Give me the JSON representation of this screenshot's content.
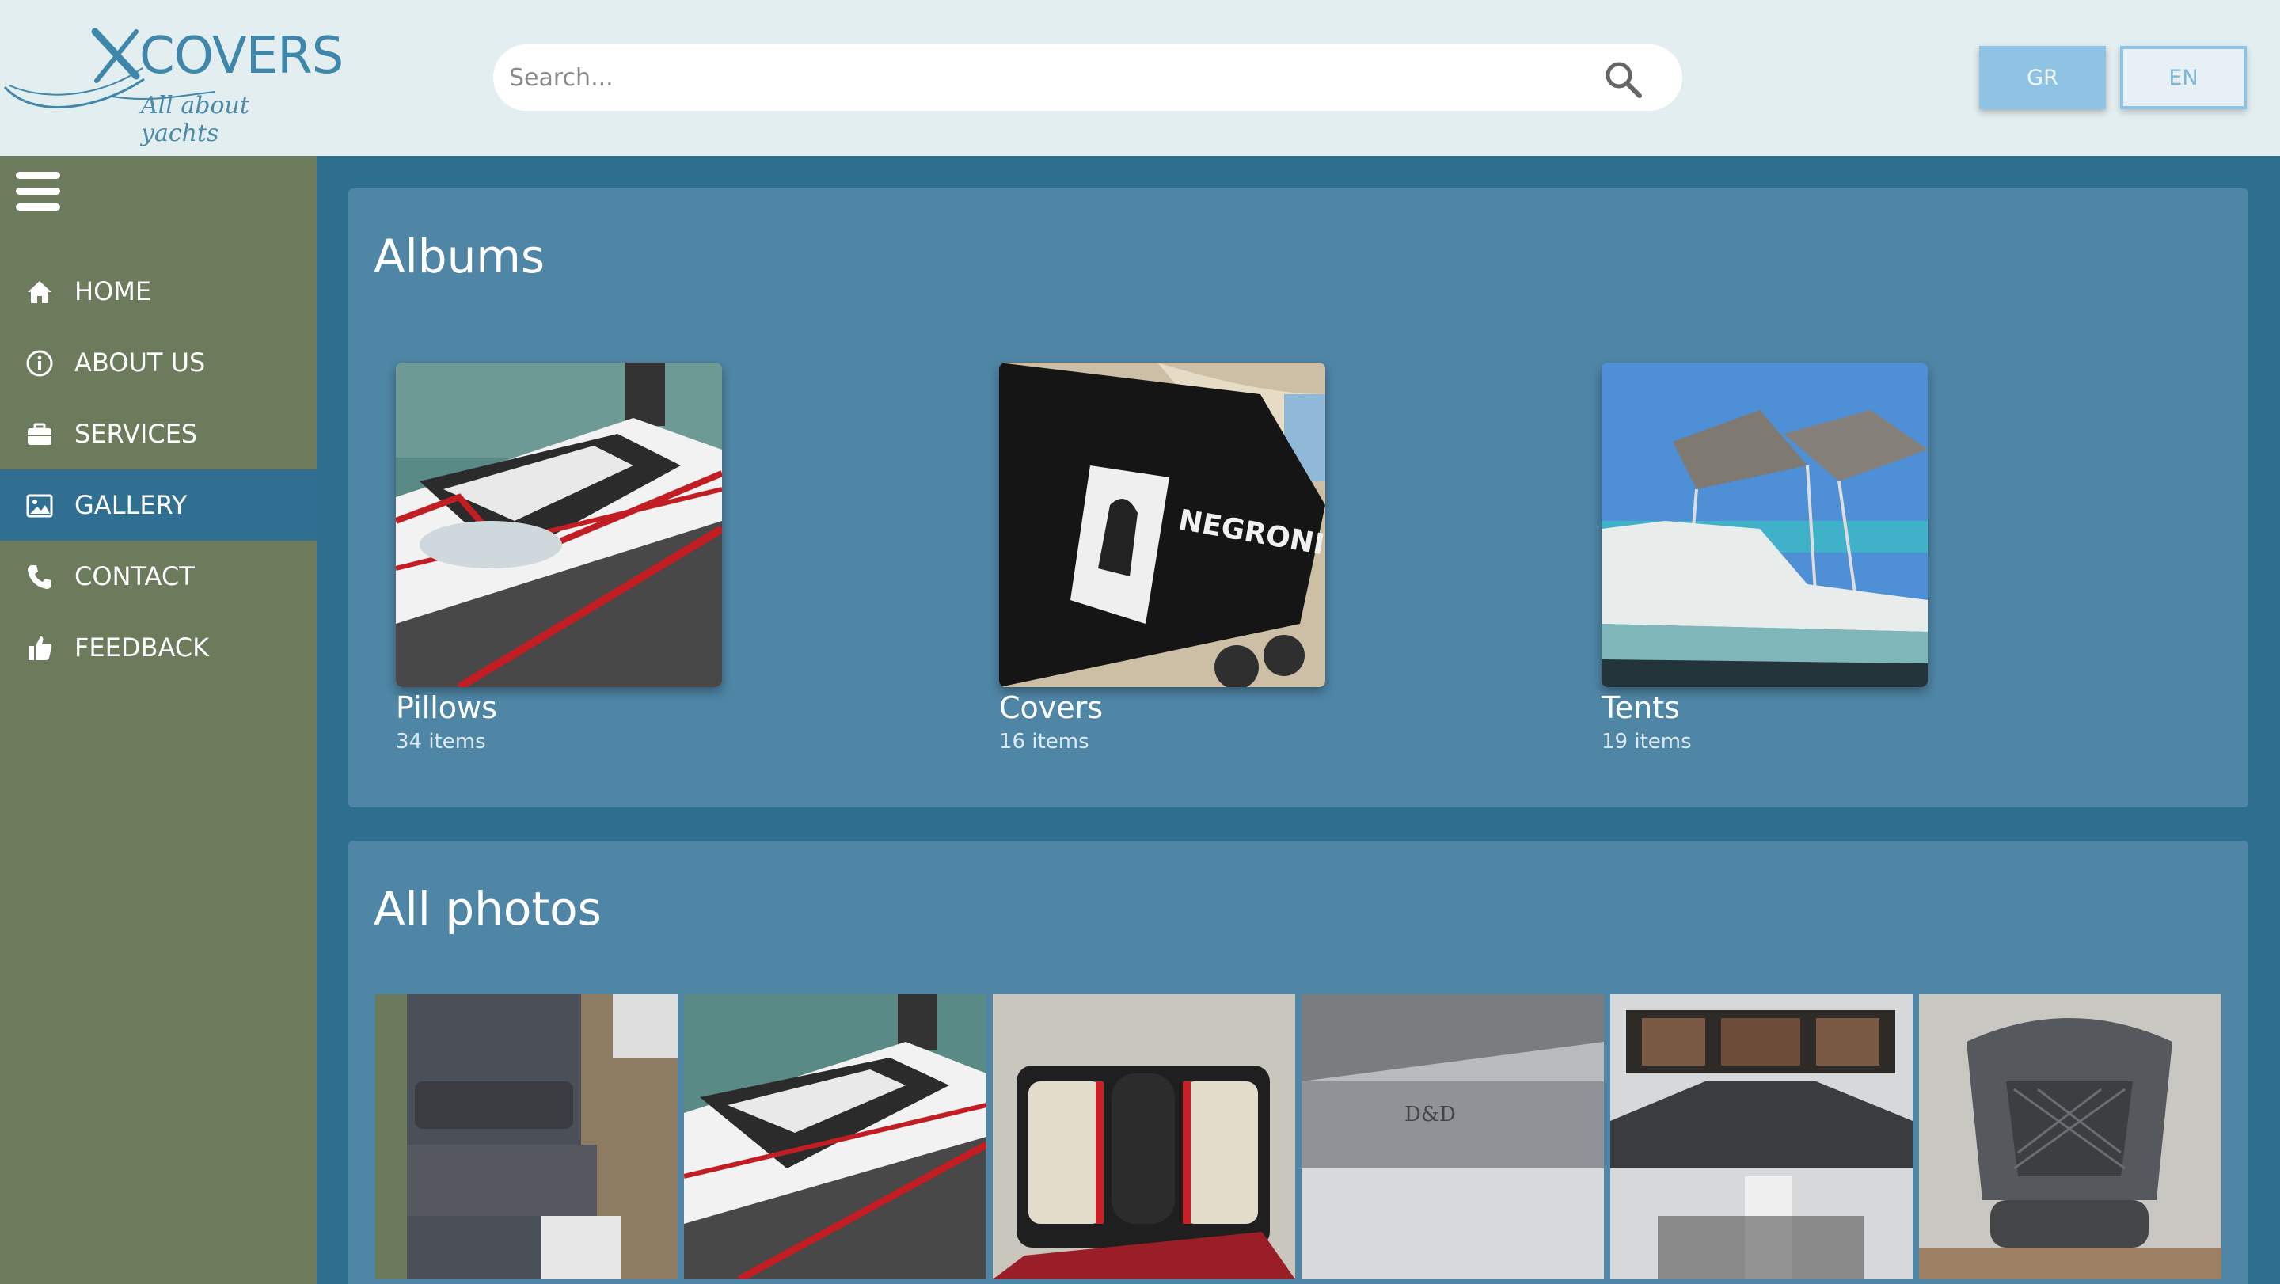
{
  "header": {
    "logo_text": "COVERS",
    "logo_tagline": "All about yachts",
    "search_placeholder": "Search...",
    "languages": [
      {
        "label": "GR",
        "active": true
      },
      {
        "label": "EN",
        "active": false
      }
    ]
  },
  "sidebar": {
    "menu_icon": "hamburger-menu-icon",
    "items": [
      {
        "label": "HOME",
        "icon": "home-icon",
        "active": false
      },
      {
        "label": "ABOUT US",
        "icon": "info-icon",
        "active": false
      },
      {
        "label": "SERVICES",
        "icon": "briefcase-icon",
        "active": false
      },
      {
        "label": "GALLERY",
        "icon": "image-icon",
        "active": true
      },
      {
        "label": "CONTACT",
        "icon": "phone-icon",
        "active": false
      },
      {
        "label": "FEEDBACK",
        "icon": "thumbs-up-icon",
        "active": false
      }
    ]
  },
  "albums_section": {
    "title": "Albums",
    "albums": [
      {
        "name": "Pillows",
        "count": "34 items"
      },
      {
        "name": "Covers",
        "count": "16 items"
      },
      {
        "name": "Tents",
        "count": "19 items"
      }
    ]
  },
  "photos_section": {
    "title": "All photos",
    "photo_count_visible": 6
  },
  "colors": {
    "header_bg": "#e2eef0",
    "sidebar_bg": "#6b7b5c",
    "sidebar_active": "#306f91",
    "page_bg": "#2e6e8e",
    "panel_bg": "#4f86a6",
    "brand": "#3f86ab",
    "lang_active": "#8ec3e4"
  }
}
